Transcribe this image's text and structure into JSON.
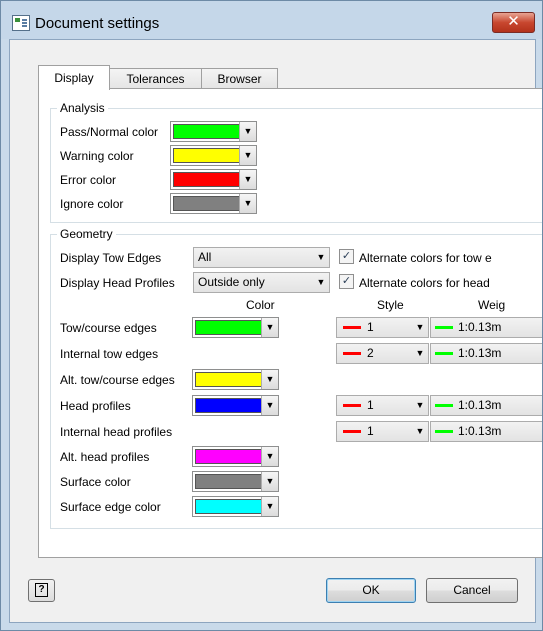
{
  "window": {
    "title": "Document settings",
    "close_glyph": "✕"
  },
  "tabs": [
    {
      "label": "Display",
      "active": true
    },
    {
      "label": "Tolerances",
      "active": false
    },
    {
      "label": "Browser",
      "active": false
    }
  ],
  "analysis": {
    "title": "Analysis",
    "rows": [
      {
        "label": "Pass/Normal color",
        "color": "#00ff00"
      },
      {
        "label": "Warning color",
        "color": "#ffff00"
      },
      {
        "label": "Error color",
        "color": "#ff0000"
      },
      {
        "label": "Ignore color",
        "color": "#808080"
      }
    ]
  },
  "geometry": {
    "title": "Geometry",
    "tow_edges": {
      "label": "Display Tow Edges",
      "value": "All",
      "alt_label": "Alternate colors for tow e",
      "alt_checked": true
    },
    "head_profiles": {
      "label": "Display Head Profiles",
      "value": "Outside only",
      "alt_label": "Alternate colors for head",
      "alt_checked": true
    },
    "columns": {
      "color": "Color",
      "style": "Style",
      "weight": "Weig"
    },
    "rows": [
      {
        "label": "Tow/course edges",
        "color": "#00ff00",
        "style": "1",
        "style_color": "#ff0000",
        "weight": "1:0.13m",
        "weight_color": "#00ff00"
      },
      {
        "label": "Internal tow edges",
        "color": null,
        "style": "2",
        "style_color": "#ff0000",
        "weight": "1:0.13m",
        "weight_color": "#00ff00"
      },
      {
        "label": "Alt. tow/course edges",
        "color": "#ffff00",
        "style": null,
        "weight": null
      },
      {
        "label": "Head profiles",
        "color": "#0000ff",
        "style": "1",
        "style_color": "#ff0000",
        "weight": "1:0.13m",
        "weight_color": "#00ff00"
      },
      {
        "label": "Internal head profiles",
        "color": null,
        "style": "1",
        "style_color": "#ff0000",
        "weight": "1:0.13m",
        "weight_color": "#00ff00"
      },
      {
        "label": "Alt. head profiles",
        "color": "#ff00ff",
        "style": null,
        "weight": null
      },
      {
        "label": "Surface color",
        "color": "#808080",
        "style": null,
        "weight": null
      },
      {
        "label": "Surface edge color",
        "color": "#00ffff",
        "style": null,
        "weight": null
      }
    ]
  },
  "buttons": {
    "help_glyph": "?",
    "ok": "OK",
    "cancel": "Cancel"
  },
  "icons": {
    "dropdown": "▼",
    "check": "✓"
  }
}
